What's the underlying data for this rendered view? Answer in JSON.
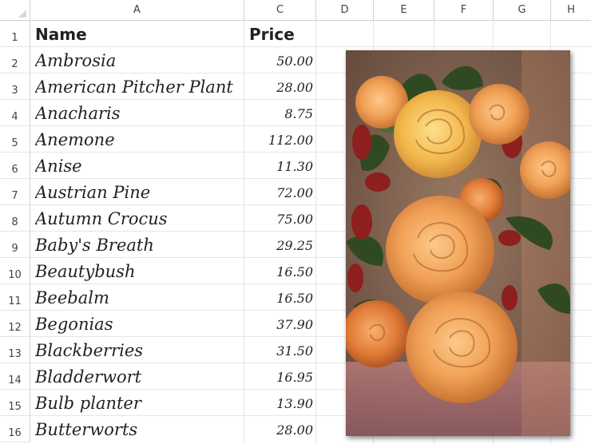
{
  "columns": [
    "A",
    "C",
    "D",
    "E",
    "F",
    "G",
    "H"
  ],
  "rows": [
    "1",
    "2",
    "3",
    "4",
    "5",
    "6",
    "7",
    "8",
    "9",
    "10",
    "11",
    "12",
    "13",
    "14",
    "15",
    "16"
  ],
  "header": {
    "name": "Name",
    "price": "Price"
  },
  "items": [
    {
      "name": "Ambrosia",
      "price": "50.00"
    },
    {
      "name": "American Pitcher Plant",
      "price": "28.00"
    },
    {
      "name": "Anacharis",
      "price": "8.75"
    },
    {
      "name": "Anemone",
      "price": "112.00"
    },
    {
      "name": "Anise",
      "price": "11.30"
    },
    {
      "name": "Austrian Pine",
      "price": "72.00"
    },
    {
      "name": "Autumn Crocus",
      "price": "75.00"
    },
    {
      "name": "Baby's Breath",
      "price": "29.25"
    },
    {
      "name": "Beautybush",
      "price": "16.50"
    },
    {
      "name": "Beebalm",
      "price": "16.50"
    },
    {
      "name": "Begonias",
      "price": "37.90"
    },
    {
      "name": "Blackberries",
      "price": "31.50"
    },
    {
      "name": "Bladderwort",
      "price": "16.95"
    },
    {
      "name": "Bulb planter",
      "price": "13.90"
    },
    {
      "name": "Butterworts",
      "price": "28.00"
    }
  ],
  "picture": {
    "subject": "roses-bouquet-photo"
  },
  "colors": {
    "rose_orange": "#f0a050",
    "rose_yellow": "#f5c255",
    "rose_red": "#a52a2a",
    "leaf_green": "#3a5a2a",
    "background": "#7a5c4e"
  }
}
